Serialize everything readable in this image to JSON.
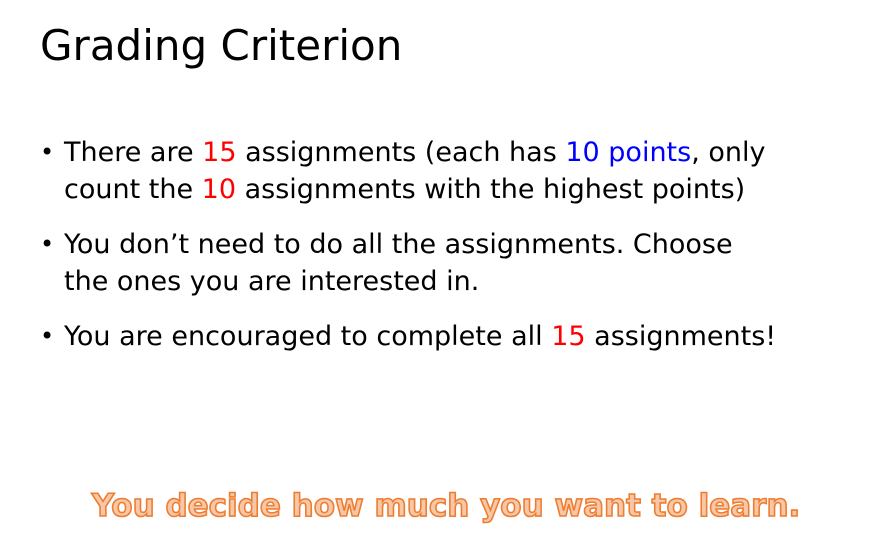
{
  "title": "Grading Criterion",
  "bullets": [
    {
      "line1": {
        "p1": "There are ",
        "n1": "15",
        "p2": " assignments (each has ",
        "pts": "10 points",
        "p3": ", only"
      },
      "line2": {
        "p1": "count the ",
        "n1": "10",
        "p2": " assignments with the highest points)"
      }
    },
    {
      "line1": "You don’t need to do all the assignments. Choose",
      "line2": "the ones you are interested in."
    },
    {
      "line1": {
        "p1": "You are encouraged to complete all ",
        "n1": "15",
        "p2": " assignments!"
      }
    }
  ],
  "tagline": "You decide how much you want to learn.",
  "colors": {
    "highlight_red": "#ff0000",
    "highlight_blue": "#0000ff",
    "tagline_fill": "#f7c8a8",
    "tagline_outline": "#ef7d31"
  }
}
